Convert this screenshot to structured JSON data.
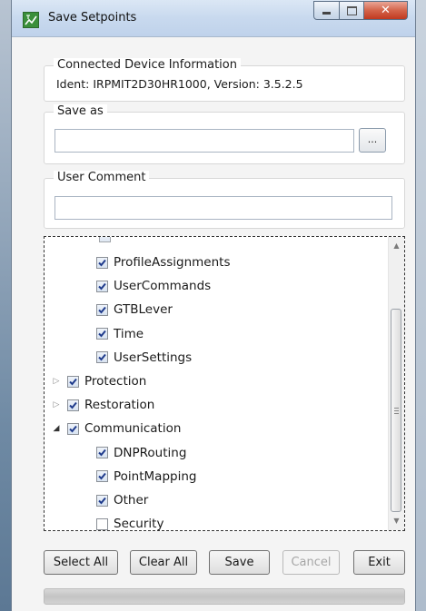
{
  "window": {
    "title": "Save Setpoints"
  },
  "device_info": {
    "legend": "Connected Device Information",
    "text": "Ident: IRPMIT2D30HR1000, Version: 3.5.2.5"
  },
  "save_as": {
    "legend": "Save as",
    "value": "",
    "browse_label": "..."
  },
  "user_comment": {
    "legend": "User Comment",
    "value": ""
  },
  "tree": {
    "items": [
      {
        "label": "ProfileAssignments",
        "checked": true,
        "level": 2
      },
      {
        "label": "UserCommands",
        "checked": true,
        "level": 2
      },
      {
        "label": "GTBLever",
        "checked": true,
        "level": 2
      },
      {
        "label": "Time",
        "checked": true,
        "level": 2
      },
      {
        "label": "UserSettings",
        "checked": true,
        "level": 2
      },
      {
        "label": "Protection",
        "checked": true,
        "level": 1,
        "expander": "collapsed"
      },
      {
        "label": "Restoration",
        "checked": true,
        "level": 1,
        "expander": "collapsed"
      },
      {
        "label": "Communication",
        "checked": true,
        "level": 1,
        "expander": "expanded"
      },
      {
        "label": "DNPRouting",
        "checked": true,
        "level": 2
      },
      {
        "label": "PointMapping",
        "checked": true,
        "level": 2
      },
      {
        "label": "Other",
        "checked": true,
        "level": 2
      },
      {
        "label": "Security",
        "checked": false,
        "level": 2
      }
    ]
  },
  "buttons": {
    "select_all": "Select All",
    "clear_all": "Clear All",
    "save": "Save",
    "cancel": "Cancel",
    "exit": "Exit"
  },
  "progress": {
    "value": 0
  },
  "colors": {
    "titlebar": "#c8d9ee",
    "close_button": "#c0391f",
    "progress_fill": "#06b025"
  }
}
